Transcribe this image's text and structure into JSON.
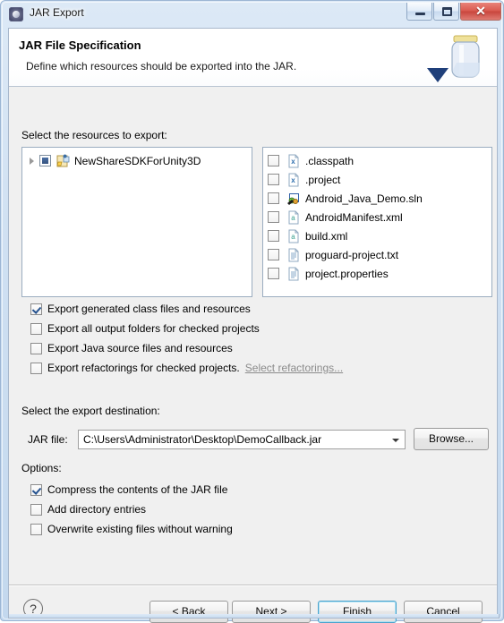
{
  "window": {
    "title": "JAR Export",
    "app_icon": "eclipse-icon",
    "controls": {
      "minimize": "minimize-icon",
      "maximize": "maximize-icon",
      "close": "✕"
    }
  },
  "banner": {
    "title": "JAR File Specification",
    "subtitle": "Define which resources should be exported into the JAR.",
    "art": "jar-jar-icon"
  },
  "resources": {
    "label": "Select the resources to export:",
    "tree": [
      {
        "label": "NewShareSDKForUnity3D",
        "checkbox_state": "grayed",
        "expanded": false,
        "icon": "java-project-icon"
      }
    ],
    "files": [
      {
        "label": ".classpath",
        "checkbox_state": "unchecked",
        "icon": "xml-x-file-icon"
      },
      {
        "label": ".project",
        "checkbox_state": "unchecked",
        "icon": "xml-x-file-icon"
      },
      {
        "label": "Android_Java_Demo.sln",
        "checkbox_state": "unchecked",
        "icon": "sln-file-icon"
      },
      {
        "label": "AndroidManifest.xml",
        "checkbox_state": "unchecked",
        "icon": "xml-a-file-icon"
      },
      {
        "label": "build.xml",
        "checkbox_state": "unchecked",
        "icon": "xml-a-file-icon"
      },
      {
        "label": "proguard-project.txt",
        "checkbox_state": "unchecked",
        "icon": "text-file-icon"
      },
      {
        "label": "project.properties",
        "checkbox_state": "unchecked",
        "icon": "text-file-icon"
      }
    ]
  },
  "export_options": [
    {
      "label": "Export generated class files and resources",
      "checked": true
    },
    {
      "label": "Export all output folders for checked projects",
      "checked": false
    },
    {
      "label": "Export Java source files and resources",
      "checked": false
    },
    {
      "label": "Export refactorings for checked projects.",
      "checked": false,
      "link": "Select refactorings..."
    }
  ],
  "destination": {
    "section_label": "Select the export destination:",
    "field_label": "JAR file:",
    "value": "C:\\Users\\Administrator\\Desktop\\DemoCallback.jar",
    "browse_label": "Browse..."
  },
  "options": {
    "section_label": "Options:",
    "items": [
      {
        "label": "Compress the contents of the JAR file",
        "checked": true
      },
      {
        "label": "Add directory entries",
        "checked": false
      },
      {
        "label": "Overwrite existing files without warning",
        "checked": false
      }
    ]
  },
  "footer": {
    "help": "?",
    "buttons": [
      {
        "label": "< Back",
        "default": false
      },
      {
        "label": "Next >",
        "default": false
      },
      {
        "label": "Finish",
        "default": true
      },
      {
        "label": "Cancel",
        "default": false
      }
    ]
  },
  "colors": {
    "accent": "#4ba3cd",
    "dialog_bg": "#f0f0f0",
    "close_red": "#d95a50"
  }
}
